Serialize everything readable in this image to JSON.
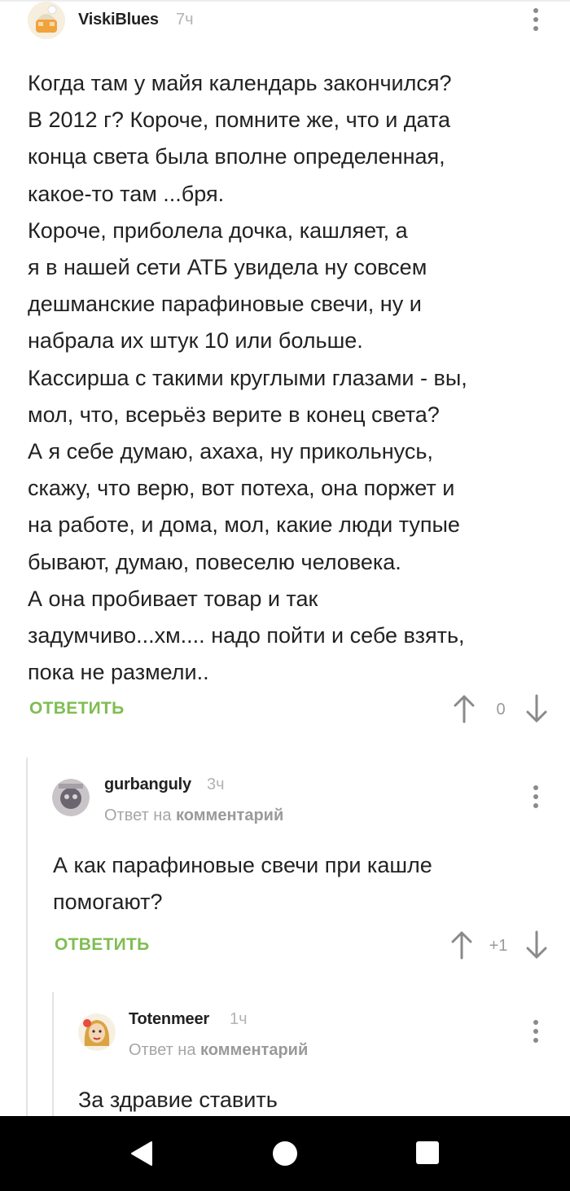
{
  "comments": [
    {
      "username": "ViskiBlues",
      "time": "7ч",
      "text": "Когда там у майя календарь закончился?\nВ 2012 г? Короче, помните же, что и дата\nконца света была вполне определенная,\nкакое-то там ...бря.\nКороче, приболела дочка, кашляет, а\nя в нашей сети АТБ увидела ну совсем\nдешманские парафиновые свечи, ну и\nнабрала их штук 10 или больше.\nКассирша с такими круглыми глазами - вы,\nмол, что, всерьёз верите в конец света?\nА я себе думаю, ахаха, ну прикольнусь,\nскажу, что верю, вот потеха, она поржет и\nна работе, и дома, мол, какие люди тупые\nбывают, думаю, повеселю человека.\nА она пробивает товар и так\nзадумчиво...хм.... надо пойти и себе взять,\nпока не размели..",
      "reply_label": "ОТВЕТИТЬ",
      "rating": "0"
    },
    {
      "username": "gurbanguly",
      "time": "3ч",
      "reply_prefix": "Ответ на",
      "reply_target": "комментарий",
      "text": "А как парафиновые свечи при кашле\nпомогают?",
      "reply_label": "ОТВЕТИТЬ",
      "rating": "+1"
    },
    {
      "username": "Totenmeer",
      "time": "1ч",
      "reply_prefix": "Ответ на",
      "reply_target": "комментарий",
      "text": "За здравие ставить"
    }
  ],
  "colors": {
    "accent": "#7fbd52",
    "text": "#222222",
    "muted": "#a6a6a6",
    "navbar": "#000000"
  },
  "icons": {
    "menu": "more-vertical-icon",
    "upvote": "arrow-up-icon",
    "downvote": "arrow-down-icon",
    "nav_back": "triangle-back-icon",
    "nav_home": "circle-home-icon",
    "nav_recents": "square-recents-icon"
  }
}
